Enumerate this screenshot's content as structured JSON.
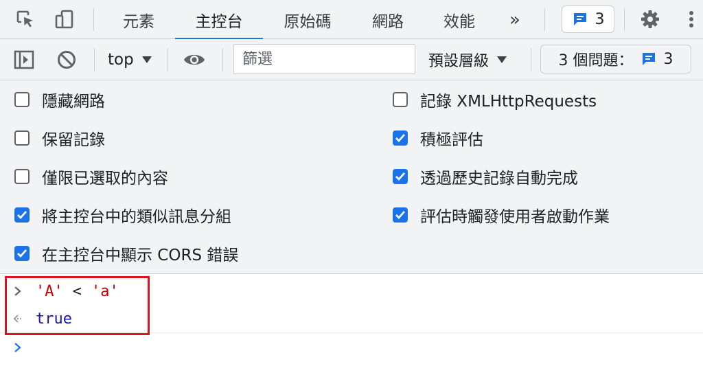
{
  "tabs": [
    {
      "label": "元素",
      "active": false
    },
    {
      "label": "主控台",
      "active": true
    },
    {
      "label": "原始碼",
      "active": false
    },
    {
      "label": "網路",
      "active": false
    },
    {
      "label": "效能",
      "active": false
    }
  ],
  "more_tabs_label": "»",
  "issues_badge_count": "3",
  "toolbar": {
    "context": "top",
    "filter_placeholder": "篩選",
    "levels": "預設層級",
    "issues_label": "3 個問題：",
    "issues_count": "3"
  },
  "settings": {
    "left": [
      {
        "label": "隱藏網路",
        "checked": false
      },
      {
        "label": "保留記錄",
        "checked": false
      },
      {
        "label": "僅限已選取的內容",
        "checked": false
      },
      {
        "label": "將主控台中的類似訊息分組",
        "checked": true
      },
      {
        "label": "在主控台中顯示 CORS 錯誤",
        "checked": true
      }
    ],
    "right": [
      {
        "label": "記錄 XMLHttpRequests",
        "checked": false
      },
      {
        "label": "積極評估",
        "checked": true
      },
      {
        "label": "透過歷史記錄自動完成",
        "checked": true
      },
      {
        "label": "評估時觸發使用者啟動作業",
        "checked": true
      }
    ]
  },
  "console": {
    "input": {
      "left": "'A'",
      "operator": "<",
      "right": "'a'"
    },
    "result": "true"
  },
  "colors": {
    "accent": "#1a73e8",
    "string": "#c80000",
    "boolean": "#1a1aa6",
    "highlight": "#e0101e"
  }
}
